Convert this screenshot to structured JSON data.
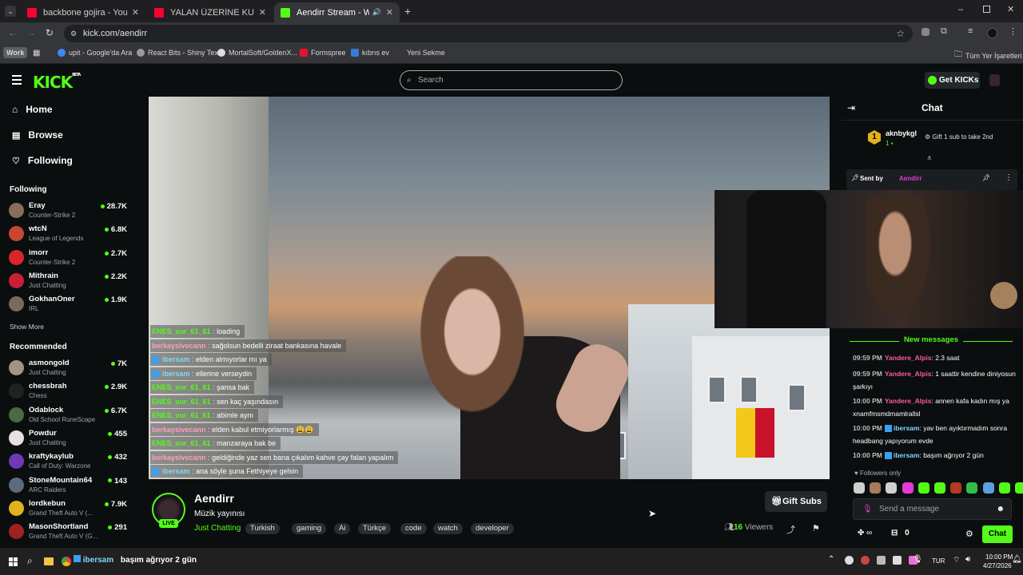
{
  "browser": {
    "tabs": [
      {
        "title": "backbone gojira - YouTube",
        "favicon_color": "#ff0033"
      },
      {
        "title": "YALAN ÜZERİNE KURULMUŞ K...",
        "favicon_color": "#ff0033"
      },
      {
        "title": "Aendirr Stream - Watch Live",
        "favicon_color": "#53fc18"
      }
    ],
    "url": "kick.com/aendirr",
    "bookmarks": [
      "Work",
      "upit - Google'da Ara",
      "React Bits - Shiny Text",
      "MortalSoft/GoldenX...",
      "Formspree",
      "kıbrıs ev",
      "Yeni Sekme",
      "Tüm Yer İşaretleri"
    ]
  },
  "header": {
    "logo": "KICK",
    "logo_beta": "BETA",
    "search_placeholder": "Search",
    "get_kicks": "Get KICKs"
  },
  "sidebar": {
    "nav": [
      "Home",
      "Browse",
      "Following"
    ],
    "following_title": "Following",
    "following": [
      {
        "name": "Eray",
        "category": "Counter-Strike 2",
        "viewers": "28.7K",
        "color": "#8a6d58"
      },
      {
        "name": "wtcN",
        "category": "League of Legends",
        "viewers": "6.8K",
        "color": "#c7462f"
      },
      {
        "name": "imorr",
        "category": "Counter-Strike 2",
        "viewers": "2.7K",
        "color": "#d9262b"
      },
      {
        "name": "Mithrain",
        "category": "Just Chatting",
        "viewers": "2.2K",
        "color": "#c81e36"
      },
      {
        "name": "GokhanOner",
        "category": "IRL",
        "viewers": "1.9K",
        "color": "#7a6a5c"
      }
    ],
    "show_more": "Show More",
    "recommended_title": "Recommended",
    "recommended": [
      {
        "name": "asmongold",
        "category": "Just Chatting",
        "viewers": "7K",
        "color": "#a7927f"
      },
      {
        "name": "chessbrah",
        "category": "Chess",
        "viewers": "2.9K",
        "color": "#222222"
      },
      {
        "name": "Odablock",
        "category": "Old School RuneScape",
        "viewers": "6.7K",
        "color": "#4b6a3f"
      },
      {
        "name": "Powdur",
        "category": "Just Chatting",
        "viewers": "455",
        "color": "#e8e0e0"
      },
      {
        "name": "kraftykaylub",
        "category": "Call of Duty: Warzone",
        "viewers": "432",
        "color": "#6f38b5"
      },
      {
        "name": "StoneMountain64",
        "category": "ARC Raiders",
        "viewers": "143",
        "color": "#5b6d7c"
      },
      {
        "name": "lordkebun",
        "category": "Grand Theft Auto V (...",
        "viewers": "7.9K",
        "color": "#e0b21d"
      },
      {
        "name": "MasonShortland",
        "category": "Grand Theft Auto V (G...",
        "viewers": "291",
        "color": "#a12121"
      }
    ]
  },
  "overlay_chat": [
    {
      "user": "ENES_vur_61_61",
      "msg": "loading",
      "color": "#53fc18",
      "icon": false
    },
    {
      "user": "berkaysivecann",
      "msg": "sağolsun bedelli ziraat bankasına havale",
      "color": "#ff9ec1",
      "icon": false
    },
    {
      "user": "ibersam",
      "msg": "elden almıyorlar mı ya",
      "color": "#7fd7ff",
      "icon": true
    },
    {
      "user": "ibersam",
      "msg": "ellerine verseydin",
      "color": "#7fd7ff",
      "icon": true
    },
    {
      "user": "ENES_vur_61_61",
      "msg": "şansa bak",
      "color": "#53fc18",
      "icon": false
    },
    {
      "user": "ENES_vur_61_61",
      "msg": "sen kaç yaşındasın",
      "color": "#53fc18",
      "icon": false
    },
    {
      "user": "ENES_vur_61_61",
      "msg": "abimle aynı",
      "color": "#53fc18",
      "icon": false
    },
    {
      "user": "berkaysivecann",
      "msg": "elden kabul etmiyorlarmış 😩😩",
      "color": "#ff9ec1",
      "icon": false
    },
    {
      "user": "ENES_vur_61_61",
      "msg": "manzaraya bak be",
      "color": "#53fc18",
      "icon": false
    },
    {
      "user": "berkaysivecann",
      "msg": "geldiğinde yaz sen bana çıkalım kahve çay falan yapalım",
      "color": "#ff9ec1",
      "icon": false
    },
    {
      "user": "ibersam",
      "msg": "ana söyle şuna Fethiyeye gelsin",
      "color": "#7fd7ff",
      "icon": true
    }
  ],
  "stream": {
    "channel": "Aendirr",
    "title": "Müzik yayınısı",
    "category": "Just Chatting",
    "tags": [
      "Turkish",
      "gaming",
      "Ai",
      "Türkçe",
      "code",
      "watch",
      "developer"
    ],
    "live_badge": "LIVE",
    "gift_subs": "Gift Subs",
    "viewers": "16",
    "viewers_label": "Viewers"
  },
  "chat": {
    "title": "Chat",
    "leader": {
      "rank": "1",
      "name": "aknbykgl",
      "count": "1"
    },
    "gift_promo": "Gift 1 sub to take 2nd",
    "pinned_label": "Sent by",
    "pinned_user": "Aendirr",
    "new_messages": "New messages",
    "messages": [
      {
        "time": "09:59 PM",
        "user": "Yandere_Alpis",
        "msg": "2.3 saat",
        "color": "#ff5aa0",
        "icon": false
      },
      {
        "time": "09:59 PM",
        "user": "Yandere_Alpis",
        "msg": "1 saattir kendine diniyosun şarkıyı",
        "color": "#ff5aa0",
        "icon": false
      },
      {
        "time": "10:00 PM",
        "user": "Yandere_Alpis",
        "msg": "annen kafa kadın mış ya xnamfmsmdmamlrallsl",
        "color": "#ff5aa0",
        "icon": false
      },
      {
        "time": "10:00 PM",
        "user": "ibersam",
        "msg": "yav ben ayıktırmadım sonra headbang yapıyorum evde",
        "color": "#7fd7ff",
        "icon": true
      },
      {
        "time": "10:00 PM",
        "user": "ibersam",
        "msg": "başım ağrıyor 2 gün",
        "color": "#7fd7ff",
        "icon": true
      }
    ],
    "followers_only": "Followers only",
    "send_placeholder": "Send a message",
    "points": "0",
    "chat_button": "Chat"
  },
  "taskbar": {
    "notification_user": "ibersam",
    "notification_msg": "başım ağrıyor 2 gün",
    "lang": "TUR",
    "time": "10:00 PM",
    "date": "4/27/2026"
  }
}
